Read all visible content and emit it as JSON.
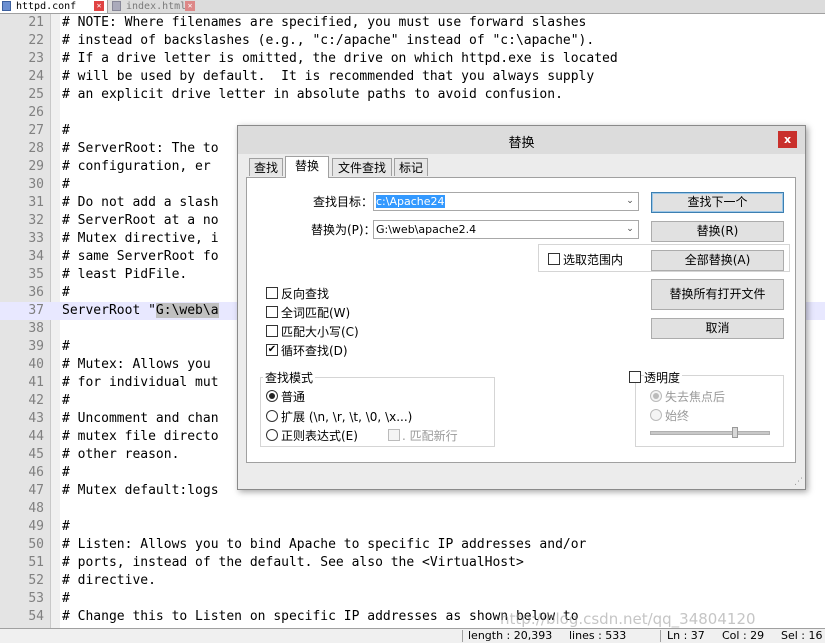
{
  "tabs": {
    "active": "httpd.conf",
    "inactive": "index.html",
    "close_glyph": "✕"
  },
  "editor": {
    "lines": [
      {
        "n": "21",
        "t": "# NOTE: Where filenames are specified, you must use forward slashes"
      },
      {
        "n": "22",
        "t": "# instead of backslashes (e.g., \"c:/apache\" instead of \"c:\\apache\")."
      },
      {
        "n": "23",
        "t": "# If a drive letter is omitted, the drive on which httpd.exe is located"
      },
      {
        "n": "24",
        "t": "# will be used by default.  It is recommended that you always supply"
      },
      {
        "n": "25",
        "t": "# an explicit drive letter in absolute paths to avoid confusion."
      },
      {
        "n": "26",
        "t": ""
      },
      {
        "n": "27",
        "t": "#"
      },
      {
        "n": "28",
        "t": "# ServerRoot: The to"
      },
      {
        "n": "29",
        "t": "# configuration, er"
      },
      {
        "n": "30",
        "t": "#"
      },
      {
        "n": "31",
        "t": "# Do not add a slash"
      },
      {
        "n": "32",
        "t": "# ServerRoot at a no"
      },
      {
        "n": "33",
        "t": "# Mutex directive, i"
      },
      {
        "n": "34",
        "t": "# same ServerRoot fo"
      },
      {
        "n": "35",
        "t": "# least PidFile."
      },
      {
        "n": "36",
        "t": "#"
      },
      {
        "n": "37",
        "t": "ServerRoot \"",
        "sel": "G:\\web\\a"
      },
      {
        "n": "38",
        "t": ""
      },
      {
        "n": "39",
        "t": "#"
      },
      {
        "n": "40",
        "t": "# Mutex: Allows you"
      },
      {
        "n": "41",
        "t": "# for individual mut"
      },
      {
        "n": "42",
        "t": "#"
      },
      {
        "n": "43",
        "t": "# Uncomment and chan"
      },
      {
        "n": "44",
        "t": "# mutex file directo"
      },
      {
        "n": "45",
        "t": "# other reason."
      },
      {
        "n": "46",
        "t": "#"
      },
      {
        "n": "47",
        "t": "# Mutex default:logs"
      },
      {
        "n": "48",
        "t": ""
      },
      {
        "n": "49",
        "t": "#"
      },
      {
        "n": "50",
        "t": "# Listen: Allows you to bind Apache to specific IP addresses and/or"
      },
      {
        "n": "51",
        "t": "# ports, instead of the default. See also the <VirtualHost>"
      },
      {
        "n": "52",
        "t": "# directive."
      },
      {
        "n": "53",
        "t": "#"
      },
      {
        "n": "54",
        "t": "# Change this to Listen on specific IP addresses as shown below to"
      }
    ]
  },
  "status": {
    "length": "length : 20,393",
    "lines": "lines : 533",
    "ln": "Ln : 37",
    "col": "Col : 29",
    "sel": "Sel : 16"
  },
  "watermark": "http://blog.csdn.net/qq_34804120",
  "dialog": {
    "title": "替换",
    "close": "x",
    "tabs": [
      "查找",
      "替换",
      "文件查找",
      "标记"
    ],
    "find_label": "查找目标：",
    "find_value": "c:\\Apache24",
    "replace_label": "替换为(P)：",
    "replace_value": "G:\\web\\apache2.4",
    "in_selection": "选取范围内",
    "buttons": {
      "find_next": "查找下一个",
      "replace": "替换(R)",
      "replace_all": "全部替换(A)",
      "replace_all_open": "替换所有打开文件",
      "cancel": "取消"
    },
    "options": {
      "backward": "反向查找",
      "whole_word": "全词匹配(W)",
      "match_case": "匹配大小写(C)",
      "wrap": "循环查找(D)"
    },
    "search_mode": {
      "title": "查找模式",
      "normal": "普通",
      "extended": "扩展 (\\n, \\r, \\t, \\0, \\x...)",
      "regex": "正则表达式(E)",
      "newline": ". 匹配新行"
    },
    "transparency": {
      "title": "透明度",
      "on_lose_focus": "失去焦点后",
      "always": "始终"
    },
    "arrow_glyph": "⌄",
    "check_glyph": "✔"
  }
}
